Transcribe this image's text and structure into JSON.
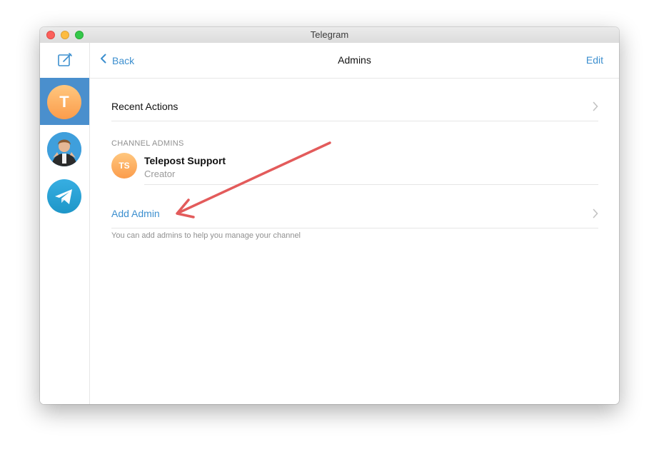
{
  "window": {
    "title": "Telegram"
  },
  "sidebar": {
    "chats": [
      {
        "initial": "T",
        "active": true
      },
      {
        "initial": "",
        "active": false
      },
      {
        "initial": "",
        "active": false
      }
    ]
  },
  "header": {
    "back_label": "Back",
    "title": "Admins",
    "edit_label": "Edit"
  },
  "recent_actions": {
    "label": "Recent Actions"
  },
  "channel_admins": {
    "section_label": "CHANNEL ADMINS",
    "admins": [
      {
        "initials": "TS",
        "name": "Telepost Support",
        "role": "Creator"
      }
    ]
  },
  "add_admin": {
    "label": "Add Admin",
    "note": "You can add admins to help you manage your channel"
  },
  "colors": {
    "accent": "#3c8fcf",
    "sidebar_active": "#4a8fcd",
    "avatar_orange": "#fb9c4b",
    "annotation_arrow": "#e35b5b"
  },
  "icons": {
    "compose": "compose-icon",
    "back": "chevron-left-icon",
    "disclosure": "chevron-right-icon",
    "telegram": "telegram-plane-icon"
  }
}
